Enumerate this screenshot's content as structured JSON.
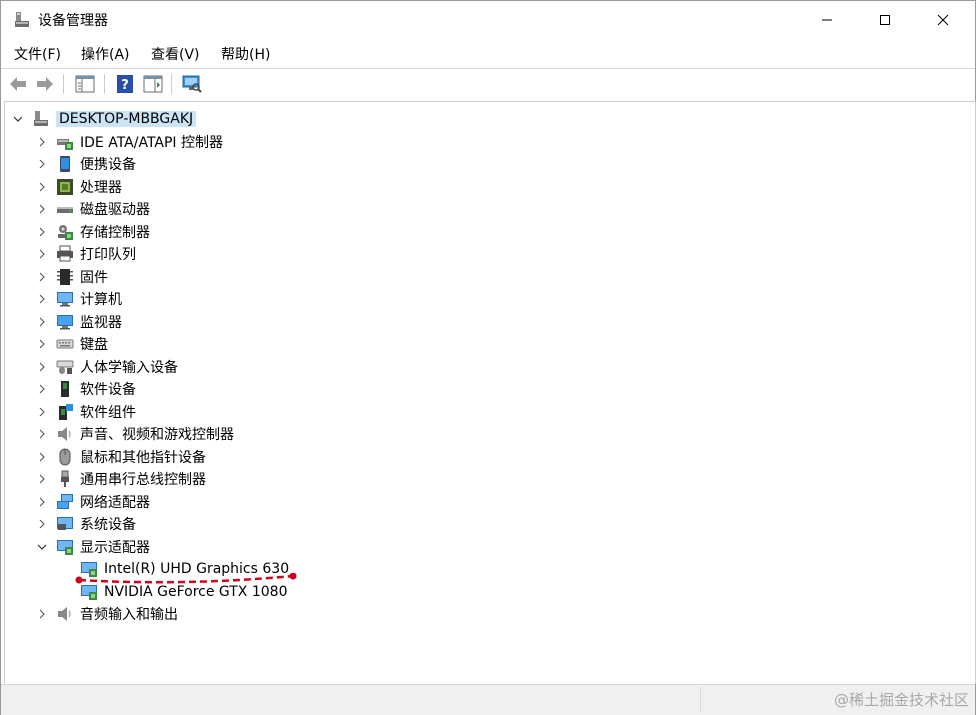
{
  "window": {
    "title": "设备管理器",
    "accent_color": "#cce4f7"
  },
  "menu": [
    {
      "label": "文件(F)"
    },
    {
      "label": "操作(A)"
    },
    {
      "label": "查看(V)"
    },
    {
      "label": "帮助(H)"
    }
  ],
  "toolbar": {
    "buttons": [
      "back-icon",
      "forward-icon",
      "properties-grid-icon",
      "help-icon",
      "details-pane-icon",
      "scan-hardware-icon"
    ]
  },
  "tree": {
    "root": {
      "label": "DESKTOP-MBBGAKJ",
      "expanded": true,
      "selected": true
    },
    "categories": [
      {
        "label": "IDE ATA/ATAPI 控制器",
        "icon": "ide-controller-icon",
        "expanded": false
      },
      {
        "label": "便携设备",
        "icon": "portable-device-icon",
        "expanded": false
      },
      {
        "label": "处理器",
        "icon": "processor-icon",
        "expanded": false
      },
      {
        "label": "磁盘驱动器",
        "icon": "disk-drive-icon",
        "expanded": false
      },
      {
        "label": "存储控制器",
        "icon": "storage-controller-icon",
        "expanded": false
      },
      {
        "label": "打印队列",
        "icon": "printer-icon",
        "expanded": false
      },
      {
        "label": "固件",
        "icon": "firmware-icon",
        "expanded": false
      },
      {
        "label": "计算机",
        "icon": "computer-icon",
        "expanded": false
      },
      {
        "label": "监视器",
        "icon": "monitor-icon",
        "expanded": false
      },
      {
        "label": "键盘",
        "icon": "keyboard-icon",
        "expanded": false
      },
      {
        "label": "人体学输入设备",
        "icon": "hid-icon",
        "expanded": false
      },
      {
        "label": "软件设备",
        "icon": "software-device-icon",
        "expanded": false
      },
      {
        "label": "软件组件",
        "icon": "software-component-icon",
        "expanded": false
      },
      {
        "label": "声音、视频和游戏控制器",
        "icon": "sound-icon",
        "expanded": false
      },
      {
        "label": "鼠标和其他指针设备",
        "icon": "mouse-icon",
        "expanded": false
      },
      {
        "label": "通用串行总线控制器",
        "icon": "usb-icon",
        "expanded": false
      },
      {
        "label": "网络适配器",
        "icon": "network-adapter-icon",
        "expanded": false
      },
      {
        "label": "系统设备",
        "icon": "system-device-icon",
        "expanded": false
      },
      {
        "label": "显示适配器",
        "icon": "display-adapter-icon",
        "expanded": true,
        "children": [
          {
            "label": "Intel(R) UHD Graphics 630",
            "icon": "display-adapter-icon"
          },
          {
            "label": "NVIDIA GeForce GTX 1080",
            "icon": "display-adapter-icon"
          }
        ]
      },
      {
        "label": "音频输入和输出",
        "icon": "audio-io-icon",
        "expanded": false
      }
    ]
  },
  "annotation": {
    "color": "#d0021b"
  },
  "status": {
    "watermark": "@稀土掘金技术社区"
  }
}
